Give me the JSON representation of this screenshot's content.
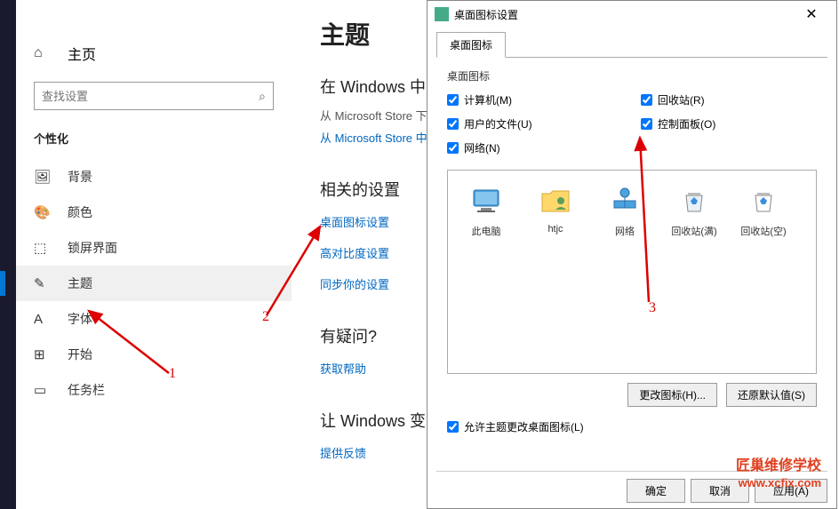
{
  "sidebar": {
    "home": "主页",
    "search_placeholder": "查找设置",
    "section": "个性化",
    "items": [
      {
        "label": "背景"
      },
      {
        "label": "颜色"
      },
      {
        "label": "锁屏界面"
      },
      {
        "label": "主题"
      },
      {
        "label": "字体"
      },
      {
        "label": "开始"
      },
      {
        "label": "任务栏"
      }
    ]
  },
  "main": {
    "title": "主题",
    "sub1": "在 Windows 中",
    "sub2": "从 Microsoft Store 下",
    "link1": "从 Microsoft Store 中",
    "related_h": "相关的设置",
    "related": [
      "桌面图标设置",
      "高对比度设置",
      "同步你的设置"
    ],
    "question_h": "有疑问?",
    "question_link": "获取帮助",
    "better_h": "让 Windows 变",
    "better_link": "提供反馈"
  },
  "dialog": {
    "title": "桌面图标设置",
    "tab": "桌面图标",
    "group": "桌面图标",
    "checks": [
      {
        "label": "计算机(M)",
        "checked": true
      },
      {
        "label": "回收站(R)",
        "checked": true
      },
      {
        "label": "用户的文件(U)",
        "checked": true
      },
      {
        "label": "控制面板(O)",
        "checked": true
      },
      {
        "label": "网络(N)",
        "checked": true
      }
    ],
    "icons": [
      "此电脑",
      "htjc",
      "网络",
      "回收站(满)",
      "回收站(空)"
    ],
    "change_icon": "更改图标(H)...",
    "restore": "还原默认值(S)",
    "allow": "允许主题更改桌面图标(L)",
    "ok": "确定",
    "cancel": "取消",
    "apply": "应用(A)"
  },
  "annotations": {
    "n1": "1",
    "n2": "2",
    "n3": "3"
  },
  "watermark": {
    "name": "匠巢维修学校",
    "url": "www.xcfix.com"
  }
}
